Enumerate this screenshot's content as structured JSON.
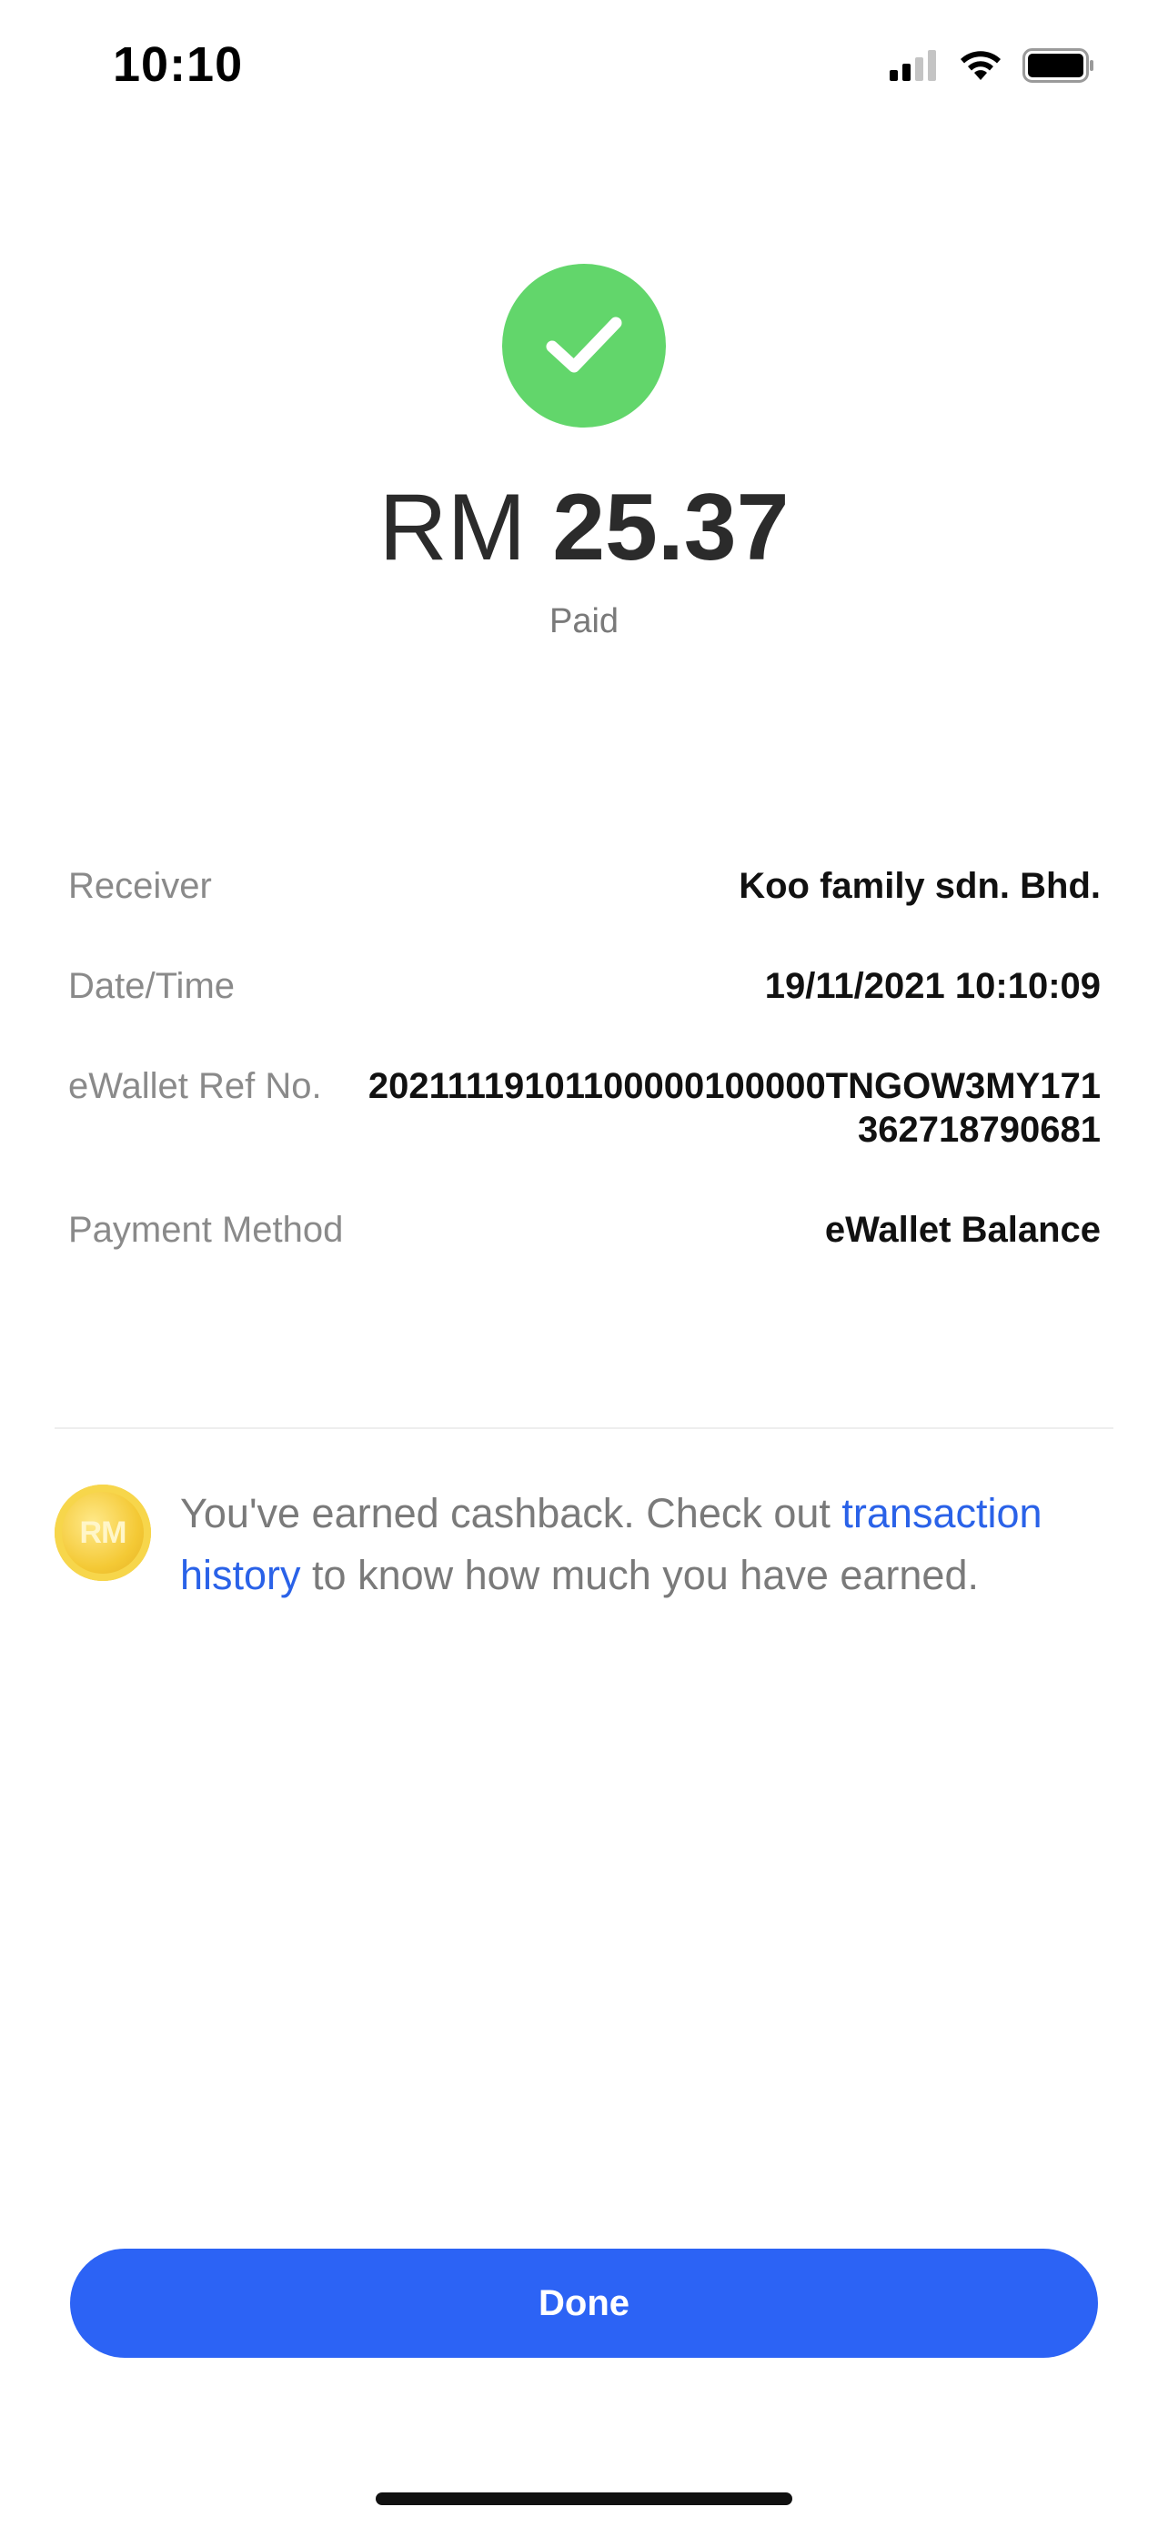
{
  "status_bar": {
    "time": "10:10",
    "icons": [
      "cellular-signal-icon",
      "wifi-icon",
      "battery-icon"
    ]
  },
  "payment": {
    "status_icon": "checkmark-icon",
    "currency": "RM",
    "amount": "25.37",
    "status": "Paid"
  },
  "details": [
    {
      "label": "Receiver",
      "value": "Koo family sdn. Bhd."
    },
    {
      "label": "Date/Time",
      "value": "19/11/2021 10:10:09"
    },
    {
      "label": "eWallet Ref No.",
      "value": "20211119101100000100000TNGOW3MY171362718790681"
    },
    {
      "label": "Payment Method",
      "value": "eWallet Balance"
    }
  ],
  "cashback": {
    "coin_icon": "rm-coin-icon",
    "coin_label": "RM",
    "text_before": "You've earned cashback. Check out ",
    "link_text": "transaction history",
    "text_after": " to know how much you have earned."
  },
  "actions": {
    "done_label": "Done"
  },
  "colors": {
    "success": "#62d66b",
    "primary": "#2c63f5",
    "link": "#2a62e8"
  }
}
